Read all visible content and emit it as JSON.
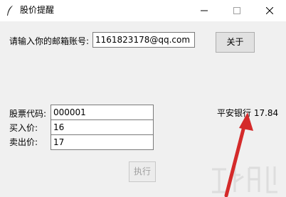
{
  "window": {
    "title": "股价提醒",
    "icon": "feather-icon"
  },
  "email": {
    "label": "请输入你的邮箱账号:",
    "value": "1161823178@qq.com"
  },
  "about_button": {
    "label": "关于"
  },
  "stock_code": {
    "label": "股票代码:",
    "value": "000001"
  },
  "buy_price": {
    "label": "买入价:",
    "value": "16"
  },
  "sell_price": {
    "label": "卖出价:",
    "value": "17"
  },
  "result": {
    "text": "平安银行 17.84"
  },
  "execute_button": {
    "label": "执行",
    "state": "disabled"
  },
  "annotation": {
    "color": "#d42a2a",
    "icon": "red-arrow-icon"
  }
}
